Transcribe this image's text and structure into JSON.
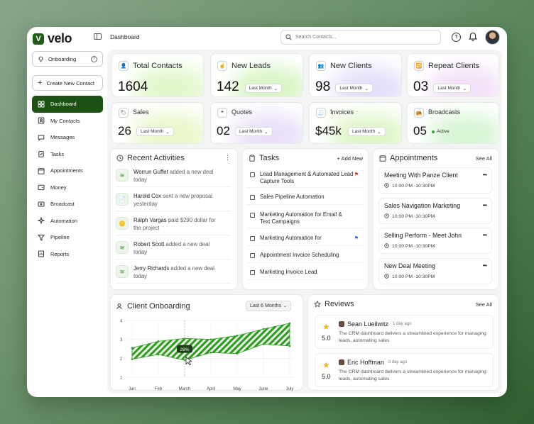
{
  "app": {
    "brand": "velo",
    "breadcrumb": "Dashboard"
  },
  "search": {
    "placeholder": "Search Contacts..."
  },
  "sidebar": {
    "filter": "Onboarding",
    "create_label": "Create New Contact",
    "items": [
      {
        "label": "Dashboard",
        "icon": "grid-icon",
        "active": true
      },
      {
        "label": "My Contacts",
        "icon": "user-icon"
      },
      {
        "label": "Messages",
        "icon": "chat-icon"
      },
      {
        "label": "Tasks",
        "icon": "clipboard-icon"
      },
      {
        "label": "Appointments",
        "icon": "calendar-icon"
      },
      {
        "label": "Money",
        "icon": "wallet-icon"
      },
      {
        "label": "Broadcast",
        "icon": "broadcast-icon"
      },
      {
        "label": "Automation",
        "icon": "sparkle-icon"
      },
      {
        "label": "Pipeline",
        "icon": "funnel-icon"
      },
      {
        "label": "Reports",
        "icon": "report-icon"
      }
    ]
  },
  "stats": [
    {
      "label": "Total Contacts",
      "value": "1604",
      "glow": "#c9f0a0"
    },
    {
      "label": "New Leads",
      "value": "142",
      "filter": "Last Month",
      "glow": "#b6ec8f"
    },
    {
      "label": "New Clients",
      "value": "98",
      "filter": "Last Month",
      "glow": "#c9c4f5"
    },
    {
      "label": "Repeat Clients",
      "value": "03",
      "filter": "Last Month",
      "glow": "#e7c6f2"
    },
    {
      "label": "Sales",
      "value": "26",
      "filter": "Last Month",
      "glow": "#d4ef9a"
    },
    {
      "label": "Quotes",
      "value": "02",
      "filter": "Last Month",
      "glow": "#d7c4f3"
    },
    {
      "label": "Invoices",
      "value": "$45k",
      "filter": "Last Month",
      "glow": "#c2ec98"
    },
    {
      "label": "Broadcasts",
      "value": "05",
      "badge": "Active",
      "glow": "#b6ecb0"
    }
  ],
  "activities": {
    "title": "Recent Activities",
    "items": [
      {
        "name": "Worrun Guffet",
        "text": " added a new deal",
        "time": "today"
      },
      {
        "name": "Harold Cox",
        "text": " sent a new proposal",
        "time": "yesterday"
      },
      {
        "name": "Ralph Vargas",
        "text": " paid $290 dollar for",
        "time": "the project"
      },
      {
        "name": "Robert Scott",
        "text": " added a new deal",
        "time": "today"
      },
      {
        "name": "Jerry Richards",
        "text": " added a new deal",
        "time": "today"
      }
    ]
  },
  "tasks": {
    "title": "Tasks",
    "add_label": "+ Add New",
    "items": [
      {
        "label": "Lead Management & Automated Lead Capture Tools",
        "flag": "red"
      },
      {
        "label": "Sales Pipeline Automation"
      },
      {
        "label": "Marketing Automation for Email & Text Campaigns"
      },
      {
        "label": "Marketing Automation for",
        "flag": "blue"
      },
      {
        "label": "Appointment Invoice Scheduling"
      },
      {
        "label": "Marketing Invoice Lead"
      }
    ]
  },
  "appointments": {
    "title": "Appointments",
    "see_all": "See All",
    "items": [
      {
        "title": "Meeting With Panze Client",
        "time": "10:00 PM -10:30PM"
      },
      {
        "title": "Sales Navigation Marketing",
        "time": "10:00 PM -10:30PM"
      },
      {
        "title": "Selling Perform - Meet John",
        "time": "10:00 PM -10:30PM"
      },
      {
        "title": "New Deal Meeting",
        "time": "10:00 PM -10:30PM"
      }
    ]
  },
  "onboarding": {
    "title": "Client Onboarding",
    "range": "Last 6 Months",
    "tooltip": "28%"
  },
  "chart_data": {
    "type": "area",
    "x": [
      "Jan",
      "Feb",
      "March",
      "April",
      "May",
      "June",
      "July"
    ],
    "ylim": [
      1,
      4
    ],
    "yticks": [
      1,
      2,
      3,
      4
    ],
    "series": [
      {
        "values": [
          2.55,
          2.9,
          3.05,
          3.0,
          3.2,
          3.55,
          3.85
        ]
      },
      {
        "values": [
          1.95,
          2.2,
          1.9,
          2.3,
          2.25,
          2.75,
          2.65
        ]
      }
    ],
    "highlight": {
      "x": "March",
      "label": "28%"
    },
    "grid": true,
    "fill_pattern": "green diagonal stripes"
  },
  "reviews": {
    "title": "Reviews",
    "see_all": "See All",
    "items": [
      {
        "name": "Sean Lueilwitz",
        "time": "1 day ago",
        "score": "5.0",
        "text": "The CRM dashboard delivers a streamlined experience for managing leads, automating sales"
      },
      {
        "name": "Eric Hoffman",
        "time": "3 day ago",
        "score": "5.0",
        "text": "The CRM dashboard delivers a streamlined experience for managing leads, automating sales"
      }
    ]
  },
  "colors": {
    "accent": "#1e5215",
    "chart_fill": "#2e9a22",
    "star": "#f2b515"
  }
}
